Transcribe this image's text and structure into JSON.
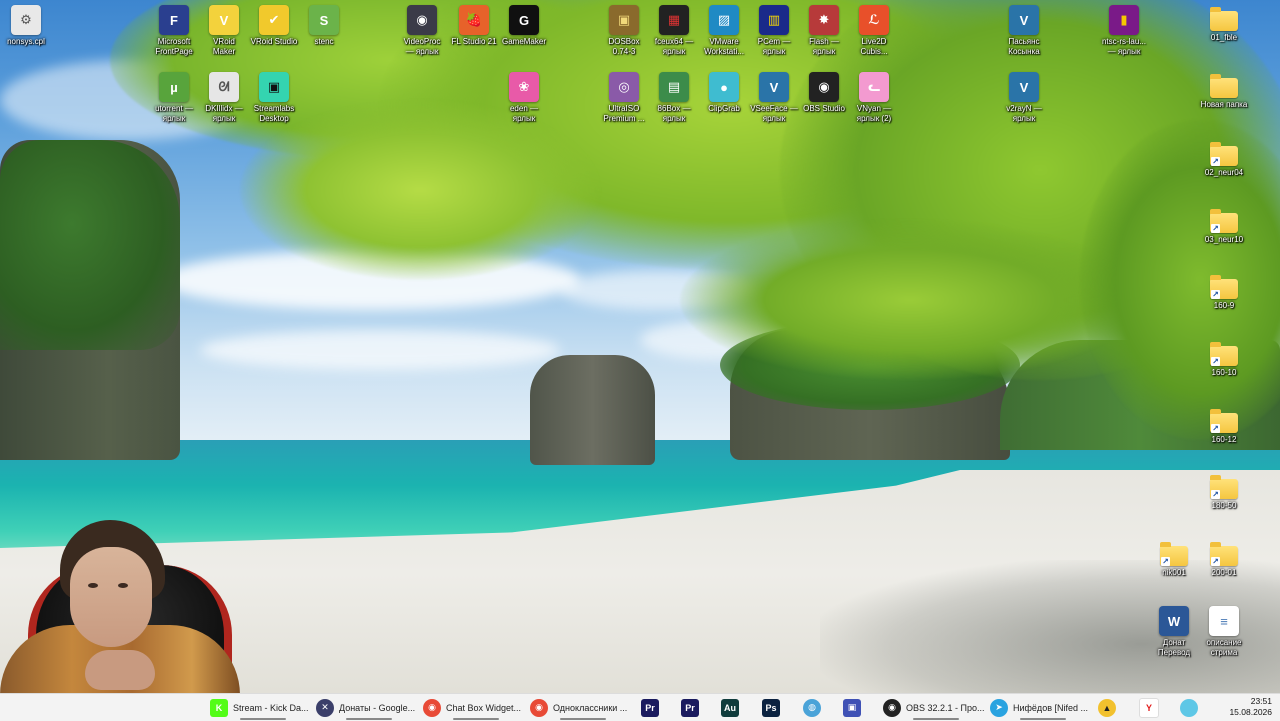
{
  "desktop_icons": [
    {
      "label": "nonsys.cpl",
      "icon": "settings-gear-icon",
      "color": "#e8e8e8",
      "glyph": "⚙",
      "fg": "#555"
    },
    {
      "label": "Microsoft\nFrontPage",
      "icon": "frontpage-icon",
      "color": "#2a3f8f",
      "glyph": "F",
      "fg": "#fff"
    },
    {
      "label": "VRoid\nMaker",
      "icon": "vroid-icon",
      "color": "#f3d23c",
      "glyph": "V",
      "fg": "#fff"
    },
    {
      "label": "VRoid Studio",
      "icon": "vroid-studio-icon",
      "color": "#f1c92c",
      "glyph": "✔",
      "fg": "#fff"
    },
    {
      "label": "stenc",
      "icon": "stencil-icon",
      "color": "#6bb34a",
      "glyph": "S",
      "fg": "#fff"
    },
    {
      "label": "VideoProc\n— ярлык",
      "icon": "videoproc-icon",
      "color": "#3b3b48",
      "glyph": "◉",
      "fg": "#fff"
    },
    {
      "label": "FL Studio 21",
      "icon": "fl-studio-icon",
      "color": "#e7622a",
      "glyph": "🍓",
      "fg": "#fff"
    },
    {
      "label": "GameMaker",
      "icon": "gamemaker-icon",
      "color": "#101010",
      "glyph": "G",
      "fg": "#fff"
    },
    {
      "label": "DOSBox\n0.74-3",
      "icon": "dosbox-icon",
      "color": "#8a6a2c",
      "glyph": "▣",
      "fg": "#f1d87a"
    },
    {
      "label": "fceux64 —\nярлык",
      "icon": "fceux-icon",
      "color": "#222",
      "glyph": "▦",
      "fg": "#d33"
    },
    {
      "label": "VMware\nWorkstati...",
      "icon": "vmware-icon",
      "color": "#1f8ac4",
      "glyph": "▨",
      "fg": "#fff"
    },
    {
      "label": "PCem —\nярлык",
      "icon": "pcem-icon",
      "color": "#1a2a8a",
      "glyph": "▥",
      "fg": "#ffde00"
    },
    {
      "label": "Flash —\nярлык",
      "icon": "flash-icon",
      "color": "#b73a3a",
      "glyph": "✸",
      "fg": "#fff"
    },
    {
      "label": "Live2D\nCubis...",
      "icon": "live2d-icon",
      "color": "#e8502a",
      "glyph": "ℒ",
      "fg": "#fff"
    },
    {
      "label": "Пасьянс\nКосынка",
      "icon": "solitaire-icon",
      "color": "#2a74a8",
      "glyph": "V",
      "fg": "#fff"
    },
    {
      "label": "ntsc-rs-lau...\n— ярлык",
      "icon": "ntsc-rs-icon",
      "color": "#7a1a88",
      "glyph": "▮",
      "fg": "#f5c800"
    },
    {
      "label": "01_fble",
      "icon": "folder-icon",
      "type": "folder"
    },
    {
      "label": "utorrent —\nярлык",
      "icon": "utorrent-icon",
      "color": "#58a43c",
      "glyph": "µ",
      "fg": "#fff"
    },
    {
      "label": "DKIllidx —\nярлык",
      "icon": "rabbit-icon",
      "color": "#e6e6e6",
      "glyph": "ᘛ",
      "fg": "#555"
    },
    {
      "label": "Streamlabs\nDesktop",
      "icon": "streamlabs-icon",
      "color": "#34d4b0",
      "glyph": "▣",
      "fg": "#111"
    },
    {
      "label": "eden —\nярлык",
      "icon": "eden-icon",
      "color": "#e85aa8",
      "glyph": "❀",
      "fg": "#fff"
    },
    {
      "label": "UltraISO\nPremium ...",
      "icon": "ultraiso-icon",
      "color": "#8a5aa8",
      "glyph": "◎",
      "fg": "#fff"
    },
    {
      "label": "86Box —\nярлык",
      "icon": "86box-icon",
      "color": "#3c8c4a",
      "glyph": "▤",
      "fg": "#fff"
    },
    {
      "label": "ClipGrab",
      "icon": "clipgrab-icon",
      "color": "#3fbcd0",
      "glyph": "●",
      "fg": "#fff"
    },
    {
      "label": "VSeeFace —\nярлык",
      "icon": "vseeface-icon",
      "color": "#2a74a8",
      "glyph": "V",
      "fg": "#fff"
    },
    {
      "label": "OBS Studio",
      "icon": "obs-icon",
      "color": "#222",
      "glyph": "◉",
      "fg": "#fff"
    },
    {
      "label": "VNyan —\nярлык (2)",
      "icon": "vnyan-icon",
      "color": "#f39ad0",
      "glyph": "ᓚ",
      "fg": "#fff"
    },
    {
      "label": "v2rayN —\nярлык",
      "icon": "v2rayn-icon",
      "color": "#2a74a8",
      "glyph": "V",
      "fg": "#fff"
    },
    {
      "label": "Новая папка",
      "icon": "folder-icon",
      "type": "folder"
    },
    {
      "label": "02_neur04",
      "icon": "folder-icon",
      "type": "folder"
    },
    {
      "label": "03_neur10",
      "icon": "folder-icon",
      "type": "folder"
    },
    {
      "label": "160-9",
      "icon": "folder-icon",
      "type": "folder"
    },
    {
      "label": "160-10",
      "icon": "folder-icon",
      "type": "folder"
    },
    {
      "label": "160-12",
      "icon": "folder-icon",
      "type": "folder"
    },
    {
      "label": "180-50",
      "icon": "folder-icon",
      "type": "folder"
    },
    {
      "label": "nik001",
      "icon": "folder-icon",
      "type": "folder"
    },
    {
      "label": "200-01",
      "icon": "folder-icon",
      "type": "folder"
    },
    {
      "label": "Донат\nПеревод",
      "icon": "word-doc-icon",
      "color": "#2b5797",
      "glyph": "W",
      "fg": "#fff"
    },
    {
      "label": "описание\nстрима",
      "icon": "text-file-icon",
      "color": "#ffffff",
      "glyph": "≡",
      "fg": "#4a7ab5"
    }
  ],
  "taskbar": {
    "items": [
      {
        "label": "Stream - Kick Da...",
        "icon": "kick-window-icon",
        "color": "#53fc18",
        "glyph": "K",
        "kind": "window"
      },
      {
        "label": "Донаты - Google...",
        "icon": "x-app-icon",
        "color": "#3b3f6a",
        "glyph": "✕",
        "kind": "window"
      },
      {
        "label": "Chat Box Widget...",
        "icon": "chrome-icon",
        "color": "#e84a36",
        "glyph": "◉",
        "kind": "window"
      },
      {
        "label": "Одноклассники ...",
        "icon": "chrome-icon",
        "color": "#e84a36",
        "glyph": "◉",
        "kind": "window"
      },
      {
        "label": "",
        "icon": "premiere-icon",
        "color": "#1a1a5e",
        "glyph": "Pr",
        "kind": "pin"
      },
      {
        "label": "",
        "icon": "premiere-icon",
        "color": "#1a1a5e",
        "glyph": "Pr",
        "kind": "pin"
      },
      {
        "label": "",
        "icon": "audition-icon",
        "color": "#103c3c",
        "glyph": "Au",
        "kind": "pin"
      },
      {
        "label": "",
        "icon": "photoshop-icon",
        "color": "#0b2240",
        "glyph": "Ps",
        "kind": "pin"
      },
      {
        "label": "",
        "icon": "globe-icon",
        "color": "#4aa3d8",
        "glyph": "◍",
        "kind": "pin"
      },
      {
        "label": "",
        "icon": "floppy-icon",
        "color": "#3f51b5",
        "glyph": "▣",
        "kind": "pin"
      },
      {
        "label": "OBS 32.2.1 - Про...",
        "icon": "obs-icon",
        "color": "#222",
        "glyph": "◉",
        "kind": "window"
      },
      {
        "label": "Нифёдов [Nifed ...",
        "icon": "telegram-icon",
        "color": "#2aa3e0",
        "glyph": "➤",
        "kind": "window"
      },
      {
        "label": "",
        "icon": "warning-icon",
        "color": "#f2c12e",
        "glyph": "▲",
        "kind": "pin"
      },
      {
        "label": "",
        "icon": "yandex-icon",
        "color": "#ffffff",
        "glyph": "Y",
        "kind": "pin"
      },
      {
        "label": "",
        "icon": "circle-app-icon",
        "color": "#5ec7e6",
        "glyph": "",
        "kind": "pin"
      }
    ],
    "clock": {
      "time": "23:51",
      "date": "15.08.2026"
    }
  }
}
